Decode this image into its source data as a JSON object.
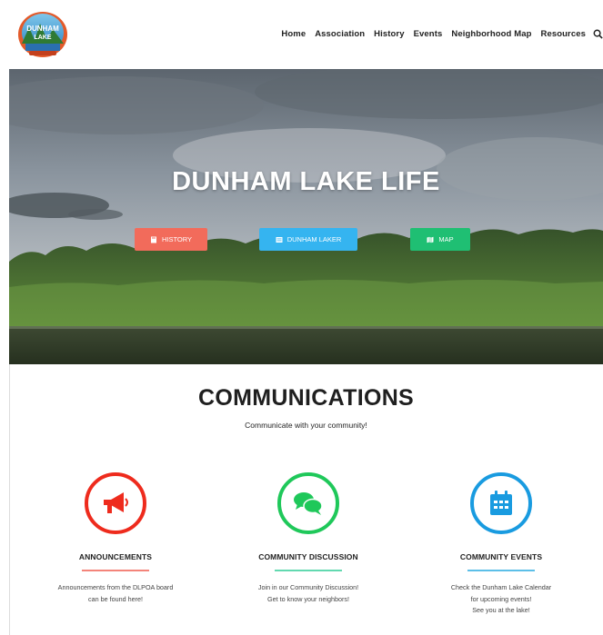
{
  "nav": {
    "items": [
      "Home",
      "Association",
      "History",
      "Events",
      "Neighborhood Map",
      "Resources"
    ]
  },
  "logo": {
    "text": "DUNHAM LAKE"
  },
  "hero": {
    "title": "DUNHAM LAKE LIFE",
    "buttons": [
      {
        "label": "HISTORY",
        "color": "#f26b5b",
        "icon": "book-icon"
      },
      {
        "label": "DUNHAM LAKER",
        "color": "#35b4f0",
        "icon": "newspaper-icon"
      },
      {
        "label": "MAP",
        "color": "#1fbf73",
        "icon": "map-icon"
      }
    ]
  },
  "communications": {
    "title": "COMMUNICATIONS",
    "subtitle": "Communicate with your community!",
    "cards": [
      {
        "title": "ANNOUNCEMENTS",
        "color": "#ee2b1d",
        "bar": "#f4847a",
        "icon": "megaphone-icon",
        "lines": [
          "Announcements from the DLPOA board",
          "can be found here!"
        ]
      },
      {
        "title": "COMMUNITY DISCUSSION",
        "color": "#1fc85a",
        "bar": "#62d9b0",
        "icon": "chat-bubbles-icon",
        "lines": [
          "Join in our Community Discussion!",
          "Get to know your neighbors!"
        ]
      },
      {
        "title": "COMMUNITY EVENTS",
        "color": "#199be0",
        "bar": "#5cbfe8",
        "icon": "calendar-icon",
        "lines": [
          "Check the Dunham Lake Calendar",
          "for upcoming events!",
          "See you at the lake!"
        ]
      }
    ]
  }
}
